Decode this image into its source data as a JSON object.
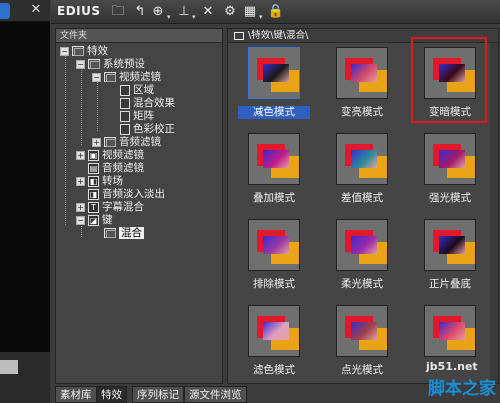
{
  "app": {
    "title": "EDIUS"
  },
  "tree": {
    "header": "文件夹",
    "items": [
      {
        "label": "特效"
      },
      {
        "label": "系统预设"
      },
      {
        "label": "视频滤镜"
      },
      {
        "label": "区域"
      },
      {
        "label": "混合效果"
      },
      {
        "label": "矩阵"
      },
      {
        "label": "色彩校正"
      },
      {
        "label": "音频滤镜"
      },
      {
        "label": "视频滤镜"
      },
      {
        "label": "音频滤镜"
      },
      {
        "label": "转场"
      },
      {
        "label": "音频淡入淡出"
      },
      {
        "label": "字幕混合"
      },
      {
        "label": "键"
      },
      {
        "label": "混合"
      }
    ]
  },
  "bottom_tabs": [
    {
      "label": "素材库"
    },
    {
      "label": "特效"
    },
    {
      "label": "序列标记"
    },
    {
      "label": "源文件浏览"
    }
  ],
  "content": {
    "breadcrumb": "\\特效\\键\\混合\\",
    "tiles": [
      {
        "label": "减色模式",
        "blend": "#1a1a1a"
      },
      {
        "label": "变亮模式",
        "blend": "#d24a6a"
      },
      {
        "label": "变暗模式",
        "blend": "#3a0a1a"
      },
      {
        "label": "叠加模式",
        "blend": "#c01a8a"
      },
      {
        "label": "差值模式",
        "blend": "#2a8a9a"
      },
      {
        "label": "强光模式",
        "blend": "#a01a6a"
      },
      {
        "label": "排除模式",
        "blend": "#9a3aa0"
      },
      {
        "label": "柔光模式",
        "blend": "#9a2aa8"
      },
      {
        "label": "正片叠底",
        "blend": "#1a0a1a"
      },
      {
        "label": "滤色模式",
        "blend": "#e0a0c0"
      },
      {
        "label": "点光模式",
        "blend": "#a0404a"
      },
      {
        "label": "",
        "blend": "#e04a6a"
      }
    ]
  },
  "watermark": {
    "line1": "jb51.net",
    "line2": "脚本之家"
  }
}
